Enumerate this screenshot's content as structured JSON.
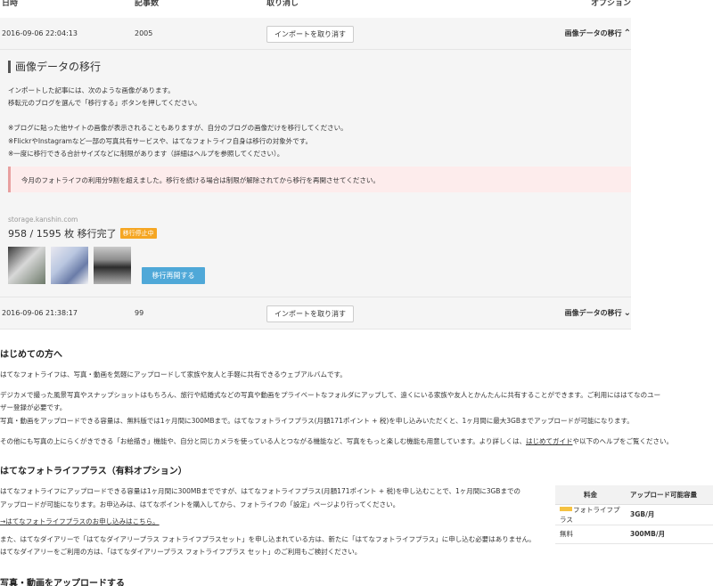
{
  "columns": {
    "date": "日時",
    "count": "記事数",
    "cancel": "取り消し",
    "option": "オプション"
  },
  "imports": [
    {
      "date": "2016-09-06 22:04:13",
      "count": "2005",
      "cancel_label": "インポートを取り消す",
      "migrate_label": "画像データの移行",
      "expanded": true
    },
    {
      "date": "2016-09-06 21:38:17",
      "count": "99",
      "cancel_label": "インポートを取り消す",
      "migrate_label": "画像データの移行",
      "expanded": false
    }
  ],
  "panel": {
    "title": "画像データの移行",
    "line1": "インポートした記事には、次のような画像があります。",
    "line2": "移転元のブログを選んで「移行する」ボタンを押してください。",
    "note1": "※ブログに貼った他サイトの画像が表示されることもありますが、自分のブログの画像だけを移行してください。",
    "note2": "※FlickrやInstagramなど一部の写真共有サービスや、はてなフォトライフ自身は移行の対象外です。",
    "note3": "※一度に移行できる合計サイズなどに制限があります（詳細はヘルプを参照してください）。",
    "alert": "今月のフォトライフの利用分9割を超えました。移行を続ける場合は制限が解除されてから移行を再開させてください。",
    "storage": "storage.kanshin.com",
    "progress": "958 / 1595 枚 移行完了",
    "status_badge": "移行停止中",
    "resume_label": "移行再開する"
  },
  "intro": {
    "heading": "はじめての方へ",
    "p1": "はてなフォトライフは、写真・動画を気軽にアップロードして家族や友人と手軽に共有できるウェブアルバムです。",
    "p2a": "デジカメで撮った風景写真やスナップショットはもちろん、旅行や結婚式などの写真や動画をプライベートなフォルダにアップして、遠くにいる家族や友人とかんたんに共有することができます。ご利用にははてなのユー",
    "p2b": "ザー登録が必要です。",
    "p3": "写真・動画をアップロードできる容量は、無料版では1ヶ月間に300MBまで。はてなフォトライフプラス(月額171ポイント + 税)を申し込みいただくと、1ヶ月間に最大3GBまでアップロードが可能になります。",
    "p4a": "その他にも写真の上にらくがきできる「お絵描き」機能や、自分と同じカメラを使っている人とつながる機能など、写真をもっと楽しむ機能も用意しています。より詳しくは、",
    "p4_link": "はじめてガイド",
    "p4b": "や以下のヘルプをご覧ください。"
  },
  "plus": {
    "heading": "はてなフォトライフプラス（有料オプション）",
    "p1a": "はてなフォトライフにアップロードできる容量は1ヶ月間に300MBまでですが、はてなフォトライフプラス(月額171ポイント + 税)を申し込むことで、1ヶ月間に3GBまでの",
    "p1b": "アップロードが可能になります。お申込みは、はてなポイントを購入してから、フォトライフの「設定」ページより行ってください。",
    "apply_link": "→はてなフォトライフプラスのお申し込みはこちら。",
    "p2": "また、はてなダイアリーで「はてなダイアリープラス フォトライフプラスセット」を申し込まれている方は、新たに「はてなフォトライフプラス」に申し込む必要はありません。",
    "p3": "はてなダイアリーをご利用の方は、「はてなダイアリープラス フォトライフプラス セット」のご利用もご検討ください。",
    "table": {
      "col_price": "料金",
      "col_capacity": "アップロード可能容量",
      "rows": [
        {
          "plan": "フォトライフプラス",
          "capacity": "3GB/月"
        },
        {
          "plan": "無料",
          "capacity": "300MB/月"
        }
      ]
    }
  },
  "upload": {
    "heading": "写真・動画をアップロードする"
  }
}
